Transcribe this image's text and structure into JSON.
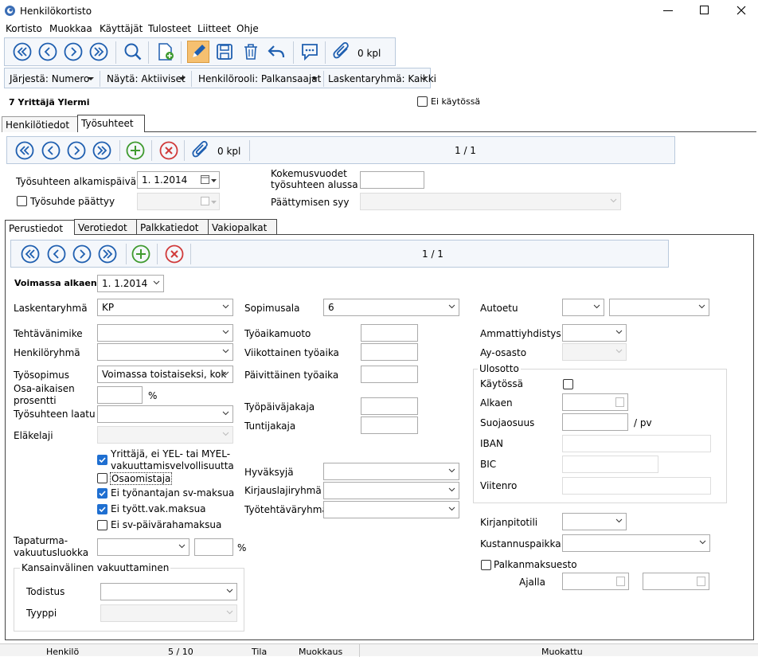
{
  "window": {
    "title": "Henkilökortisto"
  },
  "menu": [
    "Kortisto",
    "Muokkaa",
    "Käyttäjät",
    "Tulosteet",
    "Liitteet",
    "Ohje"
  ],
  "toolbar": {
    "attachments": "0 kpl"
  },
  "filters": {
    "sort": "Järjestä: Numero",
    "show": "Näytä: Aktiiviset",
    "role": "Henkilörooli: Palkansaajat",
    "group": "Laskentaryhmä: Kaikki"
  },
  "person": {
    "header": "7  Yrittäjä Ylermi",
    "inactive_label": "Ei käytössä"
  },
  "tabs_outer": [
    "Henkilötiedot",
    "Työsuhteet"
  ],
  "employment_nav": {
    "attachments": "0 kpl",
    "pager": "1 / 1"
  },
  "employment": {
    "start_label": "Työsuhteen alkamispäivä",
    "start_value": "1. 1.2014",
    "ended_label": "Työsuhde päättyy",
    "experience_label_1": "Kokemusvuodet",
    "experience_label_2": "työsuhteen alussa",
    "end_reason_label": "Päättymisen syy"
  },
  "tabs_inner": [
    "Perustiedot",
    "Verotiedot",
    "Palkkatiedot",
    "Vakiopalkat"
  ],
  "inner_nav": {
    "pager": "1 / 1"
  },
  "basic": {
    "valid_from_label": "Voimassa alkaen",
    "valid_from_value": "1.  1.2014",
    "calc_group_label": "Laskentaryhmä",
    "calc_group_value": "KP",
    "title_label": "Tehtävänimike",
    "group_label": "Henkilöryhmä",
    "contract_label": "Työsopimus",
    "contract_value": "Voimassa toistaiseksi, kok",
    "parttime_label_1": "Osa-aikaisen",
    "parttime_label_2": "prosentti",
    "percent": "%",
    "quality_label": "Työsuhteen laatu",
    "pension_label": "Eläkelaji",
    "cb1_label_1": "Yrittäjä, ei YEL- tai MYEL-",
    "cb1_label_2": "vakuuttamisvelvollisuutta",
    "cb2_label": "Osaomistaja",
    "cb3_label": "Ei työnantajan sv-maksua",
    "cb4_label": "Ei tyött.vak.maksua",
    "cb5_label": "Ei sv-päivärahamaksua",
    "accident_label_1": "Tapaturma-",
    "accident_label_2": "vakuutusluokka",
    "intl_group": "Kansainvälinen vakuuttaminen",
    "cert_label": "Todistus",
    "type_label": "Tyyppi"
  },
  "middle": {
    "agreement_label": "Sopimusala",
    "agreement_value": "6",
    "worktime_form_label": "Työaikamuoto",
    "weekly_label": "Viikottainen työaika",
    "daily_label": "Päivittäinen työaika",
    "workday_div_label": "Työpäiväjakaja",
    "hour_div_label": "Tuntijakaja",
    "approver_label": "Hyväksyjä",
    "booking_label": "Kirjauslajiryhmä",
    "task_group_label": "Työtehtäväryhmä"
  },
  "right": {
    "car_label": "Autoetu",
    "union_label": "Ammattiyhdistys",
    "branch_label": "Ay-osasto",
    "garnish_group": "Ulosotto",
    "in_use_label": "Käytössä",
    "start_label": "Alkaen",
    "protected_label": "Suojaosuus",
    "per_day": "/ pv",
    "iban_label": "IBAN",
    "bic_label": "BIC",
    "ref_label": "Viitenro",
    "ledger_label": "Kirjanpitotili",
    "cost_center_label": "Kustannuspaikka",
    "pay_ban_label": "Palkanmaksuesto",
    "period_label": "Ajalla"
  },
  "status": {
    "entity": "Henkilö",
    "position": "5 / 10",
    "state_label": "Tila",
    "state_value": "Muokkaus",
    "edited": "Muokattu"
  }
}
